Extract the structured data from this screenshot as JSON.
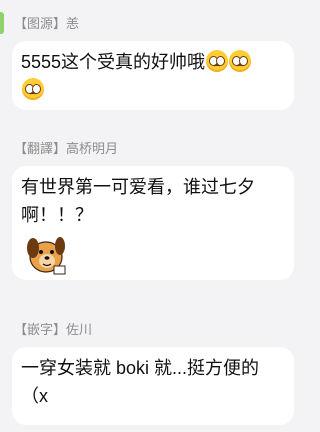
{
  "messages": [
    {
      "sender": "【图源】恙",
      "lines": [
        "5555这个受真的好帅哦",
        ""
      ],
      "emoji_name": "pleading-face"
    },
    {
      "sender": "【翻譯】高桥明月",
      "lines": [
        "有世界第一可爱看，谁过七夕",
        "啊！！？"
      ],
      "sticker_name": "cartoon-dog-sticker"
    },
    {
      "sender": "【嵌字】佐川",
      "lines": [
        "一穿女装就 boki 就...挺方便的",
        "（x"
      ]
    }
  ],
  "colors": {
    "background": "#f3f3f5",
    "bubble": "#ffffff",
    "sender_text": "#8c8c8c",
    "accent_green": "#8fd16a"
  }
}
